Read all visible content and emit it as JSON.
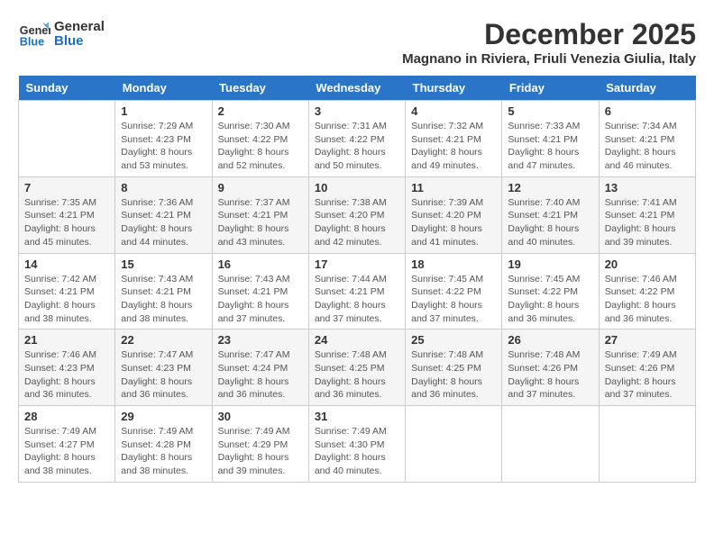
{
  "logo": {
    "line1": "General",
    "line2": "Blue"
  },
  "title": "December 2025",
  "location": "Magnano in Riviera, Friuli Venezia Giulia, Italy",
  "days_of_week": [
    "Sunday",
    "Monday",
    "Tuesday",
    "Wednesday",
    "Thursday",
    "Friday",
    "Saturday"
  ],
  "weeks": [
    [
      {
        "day": "",
        "info": ""
      },
      {
        "day": "1",
        "info": "Sunrise: 7:29 AM\nSunset: 4:23 PM\nDaylight: 8 hours\nand 53 minutes."
      },
      {
        "day": "2",
        "info": "Sunrise: 7:30 AM\nSunset: 4:22 PM\nDaylight: 8 hours\nand 52 minutes."
      },
      {
        "day": "3",
        "info": "Sunrise: 7:31 AM\nSunset: 4:22 PM\nDaylight: 8 hours\nand 50 minutes."
      },
      {
        "day": "4",
        "info": "Sunrise: 7:32 AM\nSunset: 4:21 PM\nDaylight: 8 hours\nand 49 minutes."
      },
      {
        "day": "5",
        "info": "Sunrise: 7:33 AM\nSunset: 4:21 PM\nDaylight: 8 hours\nand 47 minutes."
      },
      {
        "day": "6",
        "info": "Sunrise: 7:34 AM\nSunset: 4:21 PM\nDaylight: 8 hours\nand 46 minutes."
      }
    ],
    [
      {
        "day": "7",
        "info": "Sunrise: 7:35 AM\nSunset: 4:21 PM\nDaylight: 8 hours\nand 45 minutes."
      },
      {
        "day": "8",
        "info": "Sunrise: 7:36 AM\nSunset: 4:21 PM\nDaylight: 8 hours\nand 44 minutes."
      },
      {
        "day": "9",
        "info": "Sunrise: 7:37 AM\nSunset: 4:21 PM\nDaylight: 8 hours\nand 43 minutes."
      },
      {
        "day": "10",
        "info": "Sunrise: 7:38 AM\nSunset: 4:20 PM\nDaylight: 8 hours\nand 42 minutes."
      },
      {
        "day": "11",
        "info": "Sunrise: 7:39 AM\nSunset: 4:20 PM\nDaylight: 8 hours\nand 41 minutes."
      },
      {
        "day": "12",
        "info": "Sunrise: 7:40 AM\nSunset: 4:21 PM\nDaylight: 8 hours\nand 40 minutes."
      },
      {
        "day": "13",
        "info": "Sunrise: 7:41 AM\nSunset: 4:21 PM\nDaylight: 8 hours\nand 39 minutes."
      }
    ],
    [
      {
        "day": "14",
        "info": "Sunrise: 7:42 AM\nSunset: 4:21 PM\nDaylight: 8 hours\nand 38 minutes."
      },
      {
        "day": "15",
        "info": "Sunrise: 7:43 AM\nSunset: 4:21 PM\nDaylight: 8 hours\nand 38 minutes."
      },
      {
        "day": "16",
        "info": "Sunrise: 7:43 AM\nSunset: 4:21 PM\nDaylight: 8 hours\nand 37 minutes."
      },
      {
        "day": "17",
        "info": "Sunrise: 7:44 AM\nSunset: 4:21 PM\nDaylight: 8 hours\nand 37 minutes."
      },
      {
        "day": "18",
        "info": "Sunrise: 7:45 AM\nSunset: 4:22 PM\nDaylight: 8 hours\nand 37 minutes."
      },
      {
        "day": "19",
        "info": "Sunrise: 7:45 AM\nSunset: 4:22 PM\nDaylight: 8 hours\nand 36 minutes."
      },
      {
        "day": "20",
        "info": "Sunrise: 7:46 AM\nSunset: 4:22 PM\nDaylight: 8 hours\nand 36 minutes."
      }
    ],
    [
      {
        "day": "21",
        "info": "Sunrise: 7:46 AM\nSunset: 4:23 PM\nDaylight: 8 hours\nand 36 minutes."
      },
      {
        "day": "22",
        "info": "Sunrise: 7:47 AM\nSunset: 4:23 PM\nDaylight: 8 hours\nand 36 minutes."
      },
      {
        "day": "23",
        "info": "Sunrise: 7:47 AM\nSunset: 4:24 PM\nDaylight: 8 hours\nand 36 minutes."
      },
      {
        "day": "24",
        "info": "Sunrise: 7:48 AM\nSunset: 4:25 PM\nDaylight: 8 hours\nand 36 minutes."
      },
      {
        "day": "25",
        "info": "Sunrise: 7:48 AM\nSunset: 4:25 PM\nDaylight: 8 hours\nand 36 minutes."
      },
      {
        "day": "26",
        "info": "Sunrise: 7:48 AM\nSunset: 4:26 PM\nDaylight: 8 hours\nand 37 minutes."
      },
      {
        "day": "27",
        "info": "Sunrise: 7:49 AM\nSunset: 4:26 PM\nDaylight: 8 hours\nand 37 minutes."
      }
    ],
    [
      {
        "day": "28",
        "info": "Sunrise: 7:49 AM\nSunset: 4:27 PM\nDaylight: 8 hours\nand 38 minutes."
      },
      {
        "day": "29",
        "info": "Sunrise: 7:49 AM\nSunset: 4:28 PM\nDaylight: 8 hours\nand 38 minutes."
      },
      {
        "day": "30",
        "info": "Sunrise: 7:49 AM\nSunset: 4:29 PM\nDaylight: 8 hours\nand 39 minutes."
      },
      {
        "day": "31",
        "info": "Sunrise: 7:49 AM\nSunset: 4:30 PM\nDaylight: 8 hours\nand 40 minutes."
      },
      {
        "day": "",
        "info": ""
      },
      {
        "day": "",
        "info": ""
      },
      {
        "day": "",
        "info": ""
      }
    ]
  ]
}
